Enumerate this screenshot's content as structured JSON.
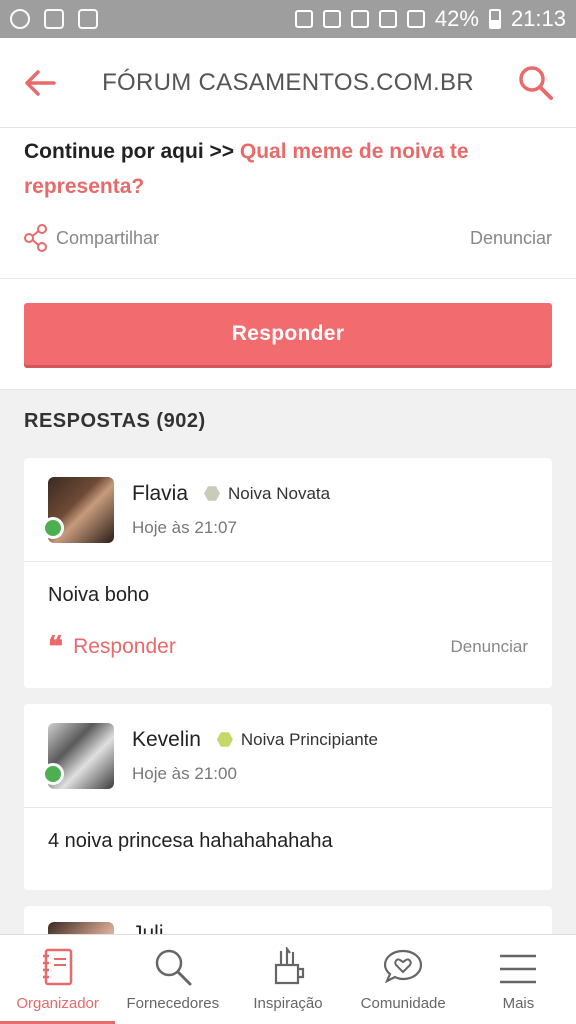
{
  "status_bar": {
    "battery": "42%",
    "time": "21:13"
  },
  "header": {
    "title": "FÓRUM CASAMENTOS.COM.BR",
    "back_icon": "arrow-left-icon",
    "search_icon": "search-icon"
  },
  "post": {
    "prefix": "Continue por aqui >> ",
    "link": "Qual meme de noiva te representa?",
    "share_label": "Compartilhar",
    "report_label": "Denunciar"
  },
  "reply_button": "Responder",
  "answers_title": "RESPOSTAS (902)",
  "answers": [
    {
      "name": "Flavia",
      "rank": "Noiva Novata",
      "rank_color": "#c9ccbb",
      "time": "Hoje às 21:07",
      "message": "Noiva boho",
      "reply": "Responder",
      "report": "Denunciar"
    },
    {
      "name": "Kevelin",
      "rank": "Noiva Principiante",
      "rank_color": "#c4d96a",
      "time": "Hoje às 21:00",
      "message": "4 noiva princesa hahahahahaha"
    }
  ],
  "third_card_partial": "Juli",
  "bottom_nav": [
    {
      "label": "Organizador",
      "icon": "notebook-icon",
      "active": true
    },
    {
      "label": "Fornecedores",
      "icon": "search-icon"
    },
    {
      "label": "Inspiração",
      "icon": "brushes-cup-icon"
    },
    {
      "label": "Comunidade",
      "icon": "heart-chat-icon"
    },
    {
      "label": "Mais",
      "icon": "menu-icon"
    }
  ],
  "colors": {
    "accent": "#e86a6a",
    "button": "#f16b6f",
    "online": "#4caf50"
  }
}
